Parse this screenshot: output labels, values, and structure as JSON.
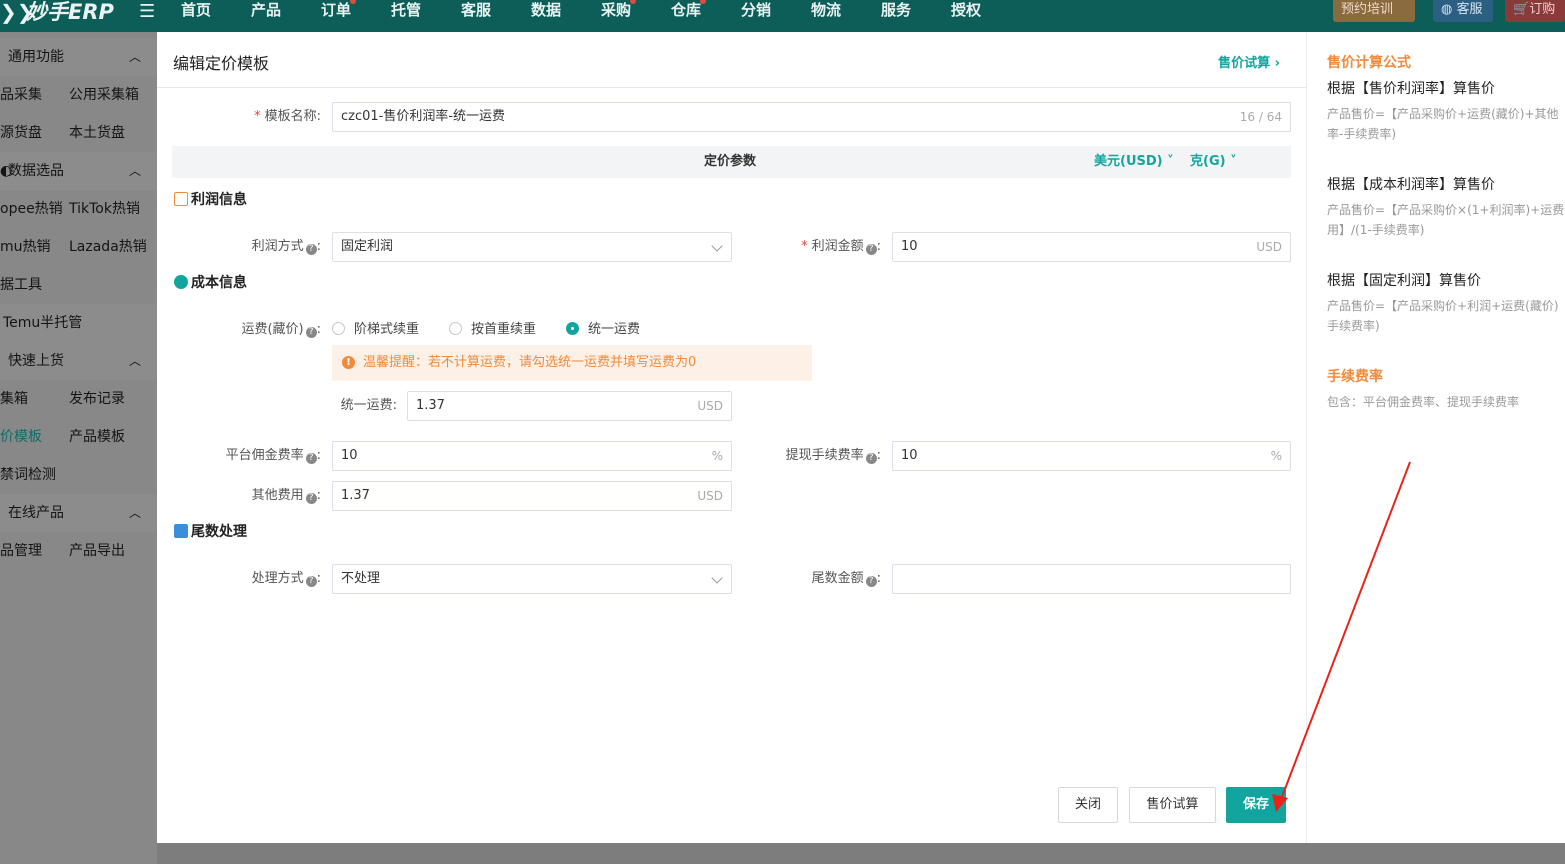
{
  "topbar": {
    "brand": "妙手ERP",
    "nav": [
      "首页",
      "产品",
      "订单",
      "托管",
      "客服",
      "数据",
      "采购",
      "仓库",
      "分销",
      "物流",
      "服务",
      "授权"
    ],
    "training_label": "预约培训",
    "service_label": "客服",
    "order_label": "订购"
  },
  "sidebar": {
    "general": "通用功能",
    "collect_left": "品采集",
    "collect_right": "公用采集箱",
    "source_left": "源货盘",
    "source_right": "本土货盘",
    "data_select": "数据选品",
    "hot_left": "opee热销",
    "hot_right": "TikTok热销",
    "hot2_left": "mu热销",
    "hot2_right": "Lazada热销",
    "tools": "据工具",
    "temu": "Temu半托管",
    "quick_list": "快速上货",
    "box_left": "集箱",
    "box_right": "发布记录",
    "tpl_left": "价模板",
    "tpl_right": "产品模板",
    "forbidden": "禁词检测",
    "online": "在线产品",
    "manage_left": "品管理",
    "manage_right": "产品导出"
  },
  "modal": {
    "title": "编辑定价模板",
    "trial_link": "售价试算 ›",
    "template_name_label": "模板名称:",
    "template_name_value": "czc01-售价利润率-统一运费",
    "template_name_count": "16 / 64",
    "params_title": "定价参数",
    "currency_label": "美元(USD)",
    "weight_label": "克(G)",
    "profit_section": "利润信息",
    "profit_method_label": "利润方式",
    "profit_method_value": "固定利润",
    "profit_amount_label": "利润金额",
    "profit_amount_value": "10",
    "cost_section": "成本信息",
    "shipping_label": "运费(藏价)",
    "radio_1": "阶梯式续重",
    "radio_2": "按首重续重",
    "radio_3": "统一运费",
    "tip_text": "温馨提醒：若不计算运费，请勾选统一运费并填写运费为0",
    "unified_label": "统一运费:",
    "unified_value": "1.37",
    "commission_label": "平台佣金费率",
    "commission_value": "10",
    "withdraw_label": "提现手续费率",
    "withdraw_value": "10",
    "other_label": "其他费用",
    "other_value": "1.37",
    "tail_section": "尾数处理",
    "tail_method_label": "处理方式",
    "tail_method_value": "不处理",
    "tail_amount_label": "尾数金额",
    "tail_amount_value": "",
    "usd": "USD",
    "pct": "%",
    "close_btn": "关闭",
    "trial_btn": "售价试算",
    "save_btn": "保存"
  },
  "formula": {
    "title": "售价计算公式",
    "h1": "根据【售价利润率】算售价",
    "d1a": "产品售价=【产品采购价+运费(藏价)+其他",
    "d1b": "率-手续费率)",
    "h2": "根据【成本利润率】算售价",
    "d2a": "产品售价=【产品采购价×(1+利润率)+运费",
    "d2b": "用】/(1-手续费率)",
    "h3": "根据【固定利润】算售价",
    "d3a": "产品售价=【产品采购价+利润+运费(藏价)",
    "d3b": "手续费率)",
    "fee_title": "手续费率",
    "fee_desc": "包含：平台佣金费率、提现手续费率"
  },
  "colors": {
    "accent": "#12a5a0",
    "warning": "#f08a3c",
    "required": "#e0453c",
    "annotation_arrow": "#e8231a"
  }
}
